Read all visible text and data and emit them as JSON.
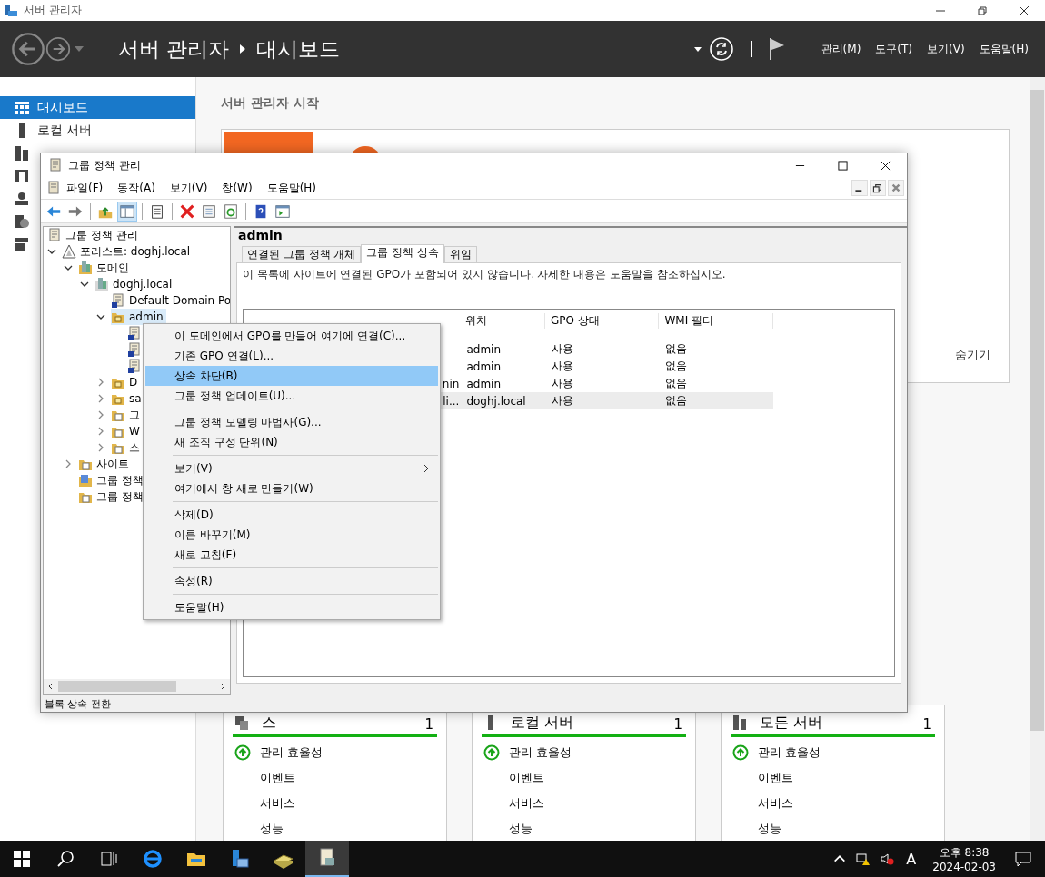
{
  "server_manager": {
    "window_title": "서버 관리자",
    "breadcrumb": [
      "서버 관리자",
      "대시보드"
    ],
    "menus": [
      "관리(M)",
      "도구(T)",
      "보기(V)",
      "도움말(H)"
    ],
    "sidebar": [
      {
        "label": "대시보드",
        "selected": true
      },
      {
        "label": "로컬 서버",
        "selected": false
      },
      {
        "selected": false
      },
      {
        "selected": false
      },
      {
        "selected": false
      },
      {
        "selected": false
      },
      {
        "selected": false
      }
    ],
    "welcome_title": "서버 관리자 시작",
    "hide_link": "숨기기",
    "cards": [
      {
        "title": "스",
        "count": "1",
        "rows": [
          {
            "label": "관리 효율성",
            "ok": true
          },
          {
            "label": "이벤트",
            "ok": false
          },
          {
            "label": "서비스",
            "ok": false
          },
          {
            "label": "성능",
            "ok": false
          }
        ]
      },
      {
        "title": "로컬 서버",
        "count": "1",
        "rows": [
          {
            "label": "관리 효율성",
            "ok": true
          },
          {
            "label": "이벤트",
            "ok": false
          },
          {
            "label": "서비스",
            "ok": false
          },
          {
            "label": "성능",
            "ok": false
          }
        ]
      },
      {
        "title": "모든 서버",
        "count": "1",
        "rows": [
          {
            "label": "관리 효율성",
            "ok": true
          },
          {
            "label": "이벤트",
            "ok": false
          },
          {
            "label": "서비스",
            "ok": false
          },
          {
            "label": "성능",
            "ok": false
          }
        ]
      }
    ]
  },
  "gpm": {
    "title": "그룹 정책 관리",
    "menus": [
      "파일(F)",
      "동작(A)",
      "보기(V)",
      "창(W)",
      "도움말(H)"
    ],
    "toolbar": [
      {
        "kind": "back",
        "selected": false
      },
      {
        "kind": "forward",
        "selected": false
      },
      {
        "kind": "up",
        "selected": false
      },
      {
        "kind": "pane",
        "selected": true
      },
      {
        "kind": "clipboard",
        "selected": false
      },
      {
        "kind": "delete",
        "selected": false
      },
      {
        "kind": "properties",
        "selected": false
      },
      {
        "kind": "refresh",
        "selected": false
      },
      {
        "kind": "help",
        "selected": false
      },
      {
        "kind": "view",
        "selected": false
      }
    ],
    "tree": [
      {
        "label": "그룹 정책 관리",
        "kind": "scroll",
        "selected": false,
        "children": [
          {
            "label": "포리스트: doghj.local",
            "kind": "forest",
            "expanded": true,
            "selected": false,
            "children": [
              {
                "label": "도메인",
                "kind": "domains",
                "expanded": true,
                "selected": false,
                "children": [
                  {
                    "label": "doghj.local",
                    "kind": "domain",
                    "expanded": true,
                    "selected": false,
                    "children": [
                      {
                        "label": "Default Domain Po",
                        "kind": "link",
                        "selected": false
                      },
                      {
                        "label": "admin",
                        "kind": "ou",
                        "expanded": true,
                        "selected": true,
                        "children": [
                          {
                            "kind": "link",
                            "selected": false
                          },
                          {
                            "kind": "link",
                            "selected": false
                          },
                          {
                            "kind": "link",
                            "selected": false
                          }
                        ]
                      },
                      {
                        "label": "D",
                        "kind": "ou",
                        "expanded": false,
                        "selected": false
                      },
                      {
                        "label": "sa",
                        "kind": "ou",
                        "expanded": false,
                        "selected": false
                      },
                      {
                        "label": "그",
                        "kind": "folder",
                        "expanded": false,
                        "selected": false
                      },
                      {
                        "label": "W",
                        "kind": "folder",
                        "expanded": false,
                        "selected": false
                      },
                      {
                        "label": "스",
                        "kind": "folder",
                        "expanded": false,
                        "selected": false
                      }
                    ]
                  }
                ]
              },
              {
                "label": "사이트",
                "kind": "folder",
                "expanded": false,
                "selected": false
              },
              {
                "label": "그룹 정책",
                "kind": "modeling",
                "selected": false
              },
              {
                "label": "그룹 정책",
                "kind": "folder",
                "selected": false
              }
            ]
          }
        ]
      }
    ],
    "detail": {
      "title": "admin",
      "tabs": [
        {
          "label": "연결된 그룹 정책 개체",
          "selected": false
        },
        {
          "label": "그룹 정책 상속",
          "selected": true
        },
        {
          "label": "위임",
          "selected": false
        }
      ],
      "info": "이 목록에 사이트에 연결된 GPO가 포함되어 있지 않습니다. 자세한 내용은 도움말을 참조하십시오.",
      "columns": [
        "위치",
        "GPO 상태",
        "WMI 필터"
      ],
      "rows": [
        {
          "cells": [
            "admin",
            "사용",
            "없음"
          ],
          "selected": false
        },
        {
          "cells": [
            "admin",
            "사용",
            "없음"
          ],
          "selected": false
        },
        {
          "column_2": "nin",
          "cells": [
            "admin",
            "사용",
            "없음"
          ],
          "selected": false
        },
        {
          "column_2": "li...",
          "cells": [
            "doghj.local",
            "사용",
            "없음"
          ],
          "selected": true
        }
      ]
    },
    "status_bar": "블록 상속 전환"
  },
  "context_menu": [
    [
      {
        "label": "이 도메인에서 GPO를 만들어 여기에 연결(C)...",
        "selected": false
      },
      {
        "label": "기존 GPO 연결(L)...",
        "selected": false
      },
      {
        "label": "상속 차단(B)",
        "selected": true
      },
      {
        "label": "그룹 정책 업데이트(U)...",
        "selected": false
      }
    ],
    [
      {
        "label": "그룹 정책 모델링 마법사(G)...",
        "selected": false
      },
      {
        "label": "새 조직 구성 단위(N)",
        "selected": false
      }
    ],
    [
      {
        "label": "보기(V)",
        "selected": false,
        "submenu": true
      },
      {
        "label": "여기에서 창 새로 만들기(W)",
        "selected": false
      }
    ],
    [
      {
        "label": "삭제(D)",
        "selected": false
      },
      {
        "label": "이름 바꾸기(M)",
        "selected": false
      },
      {
        "label": "새로 고침(F)",
        "selected": false
      }
    ],
    [
      {
        "label": "속성(R)",
        "selected": false
      }
    ],
    [
      {
        "label": "도움말(H)",
        "selected": false
      }
    ]
  ],
  "taskbar": {
    "apps": [
      {
        "kind": "start",
        "active": false
      },
      {
        "kind": "search",
        "active": false
      },
      {
        "kind": "taskview",
        "active": false
      },
      {
        "kind": "browser",
        "active": false
      },
      {
        "kind": "explorer",
        "active": false
      },
      {
        "kind": "servermanager",
        "active": false
      },
      {
        "kind": "drive",
        "active": false
      },
      {
        "kind": "scroll",
        "active": true
      }
    ],
    "ime": "A",
    "time": "오후 8:38",
    "date": "2024-02-03"
  }
}
